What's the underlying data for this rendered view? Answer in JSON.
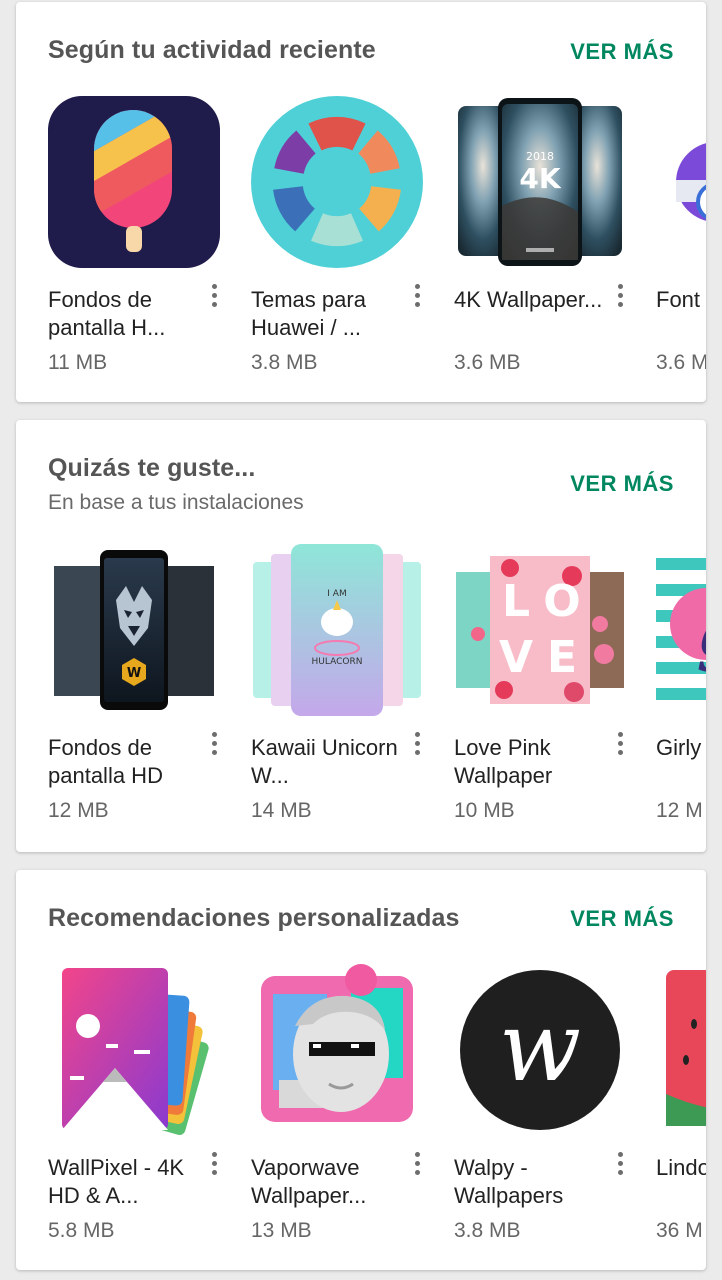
{
  "sections": [
    {
      "title": "Según tu actividad reciente",
      "more": "VER MÁS",
      "apps": [
        {
          "name": "Fondos de pantalla H...",
          "size": "11 MB",
          "icon": "popsicle-icon"
        },
        {
          "name": "Temas para Huawei / ...",
          "size": "3.8 MB",
          "icon": "color-ring-icon"
        },
        {
          "name": "4K Wallpaper...",
          "size": "3.6 MB",
          "icon": "phone-4k-icon"
        },
        {
          "name": "Font Mana",
          "size": "3.6 M",
          "icon": "font-manager-icon"
        }
      ]
    },
    {
      "title": "Quizás te guste...",
      "subtitle": "En base a tus instalaciones",
      "more": "VER MÁS",
      "apps": [
        {
          "name": "Fondos de pantalla HD",
          "size": "12 MB",
          "icon": "wolf-phone-icon"
        },
        {
          "name": "Kawaii Unicorn W...",
          "size": "14 MB",
          "icon": "unicorn-phone-icon"
        },
        {
          "name": "Love Pink Wallpaper",
          "size": "10 MB",
          "icon": "love-roses-icon"
        },
        {
          "name": "Girly Wallp",
          "size": "12 M",
          "icon": "girly-stripes-icon"
        }
      ]
    },
    {
      "title": "Recomendaciones personalizadas",
      "more": "VER MÁS",
      "apps": [
        {
          "name": "WallPixel - 4K HD & A...",
          "size": "5.8 MB",
          "icon": "wallpixel-icon"
        },
        {
          "name": "Vaporwave Wallpaper...",
          "size": "13 MB",
          "icon": "vaporwave-statue-icon"
        },
        {
          "name": "Walpy - Wallpapers",
          "size": "3.8 MB",
          "icon": "walpy-w-icon"
        },
        {
          "name": "Lindo fond",
          "size": "36 M",
          "icon": "watermelon-icon"
        }
      ]
    }
  ],
  "icon_text": {
    "four_k": "4K",
    "year": "2018",
    "w_badge": "W",
    "hulacorn": "HULACORN",
    "i_am": "I AM",
    "love_l": "L",
    "love_o": "O",
    "love_v": "V",
    "love_e": "E",
    "walpy_letter": "w",
    "girly_letter": "g"
  }
}
